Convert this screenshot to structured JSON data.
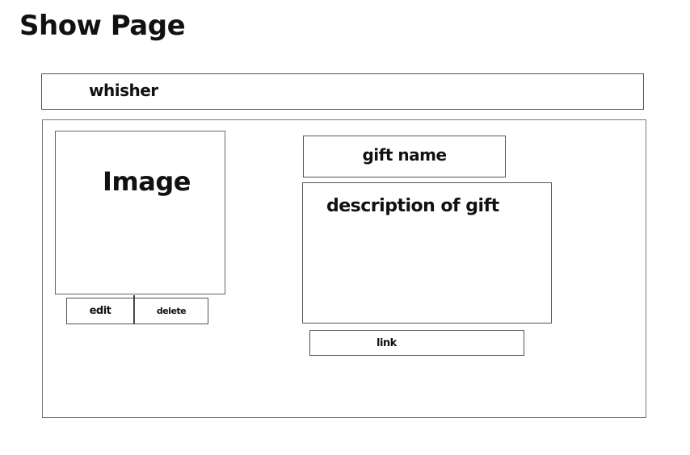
{
  "page": {
    "title": "Show Page"
  },
  "navbar": {
    "brand": "whisher"
  },
  "gift": {
    "image_placeholder": "Image",
    "name": "gift name",
    "description": "description of gift"
  },
  "actions": {
    "edit_label": "edit",
    "delete_label": "delete",
    "link_label": "link"
  }
}
